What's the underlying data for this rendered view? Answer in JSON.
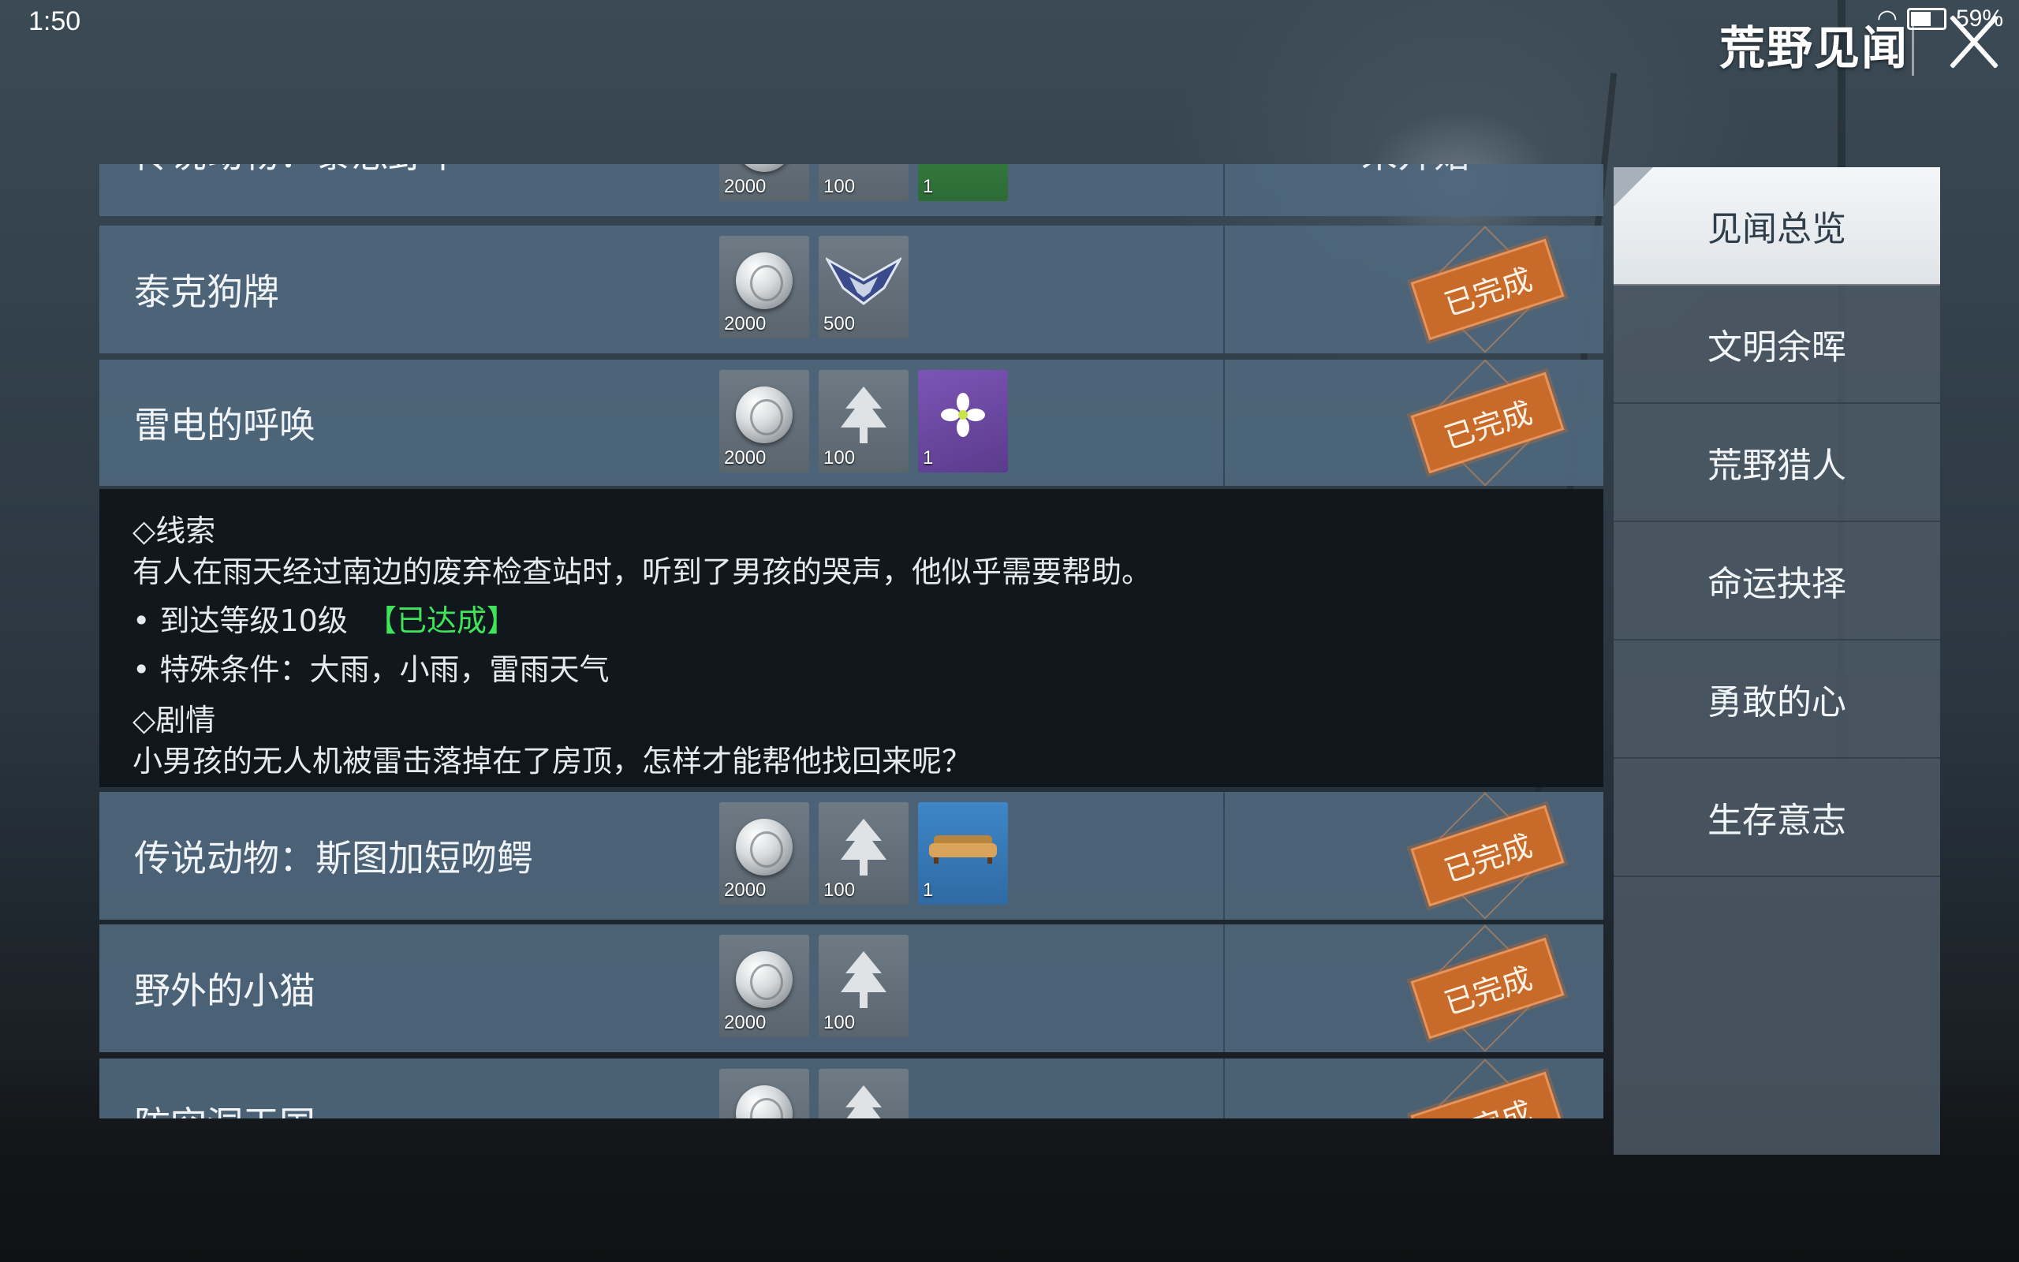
{
  "status_bar": {
    "time": "1:50",
    "battery": "59%"
  },
  "header": {
    "title": "荒野见闻"
  },
  "sidebar": {
    "tabs": [
      {
        "label": "见闻总览",
        "active": true
      },
      {
        "label": "文明余晖",
        "active": false
      },
      {
        "label": "荒野猎人",
        "active": false
      },
      {
        "label": "命运抉择",
        "active": false
      },
      {
        "label": "勇敢的心",
        "active": false
      },
      {
        "label": "生存意志",
        "active": false
      }
    ]
  },
  "quests": [
    {
      "name": "传说动物：泰怒野牛",
      "rewards": [
        {
          "type": "coin",
          "qty": "2000"
        },
        {
          "type": "badge",
          "qty": "100"
        },
        {
          "type": "green",
          "qty": "1"
        }
      ],
      "status": "未开始"
    },
    {
      "name": "泰克狗牌",
      "rewards": [
        {
          "type": "coin",
          "qty": "2000"
        },
        {
          "type": "badge",
          "qty": "500"
        }
      ],
      "status": "已完成"
    },
    {
      "name": "雷电的呼唤",
      "rewards": [
        {
          "type": "coin",
          "qty": "2000"
        },
        {
          "type": "tree",
          "qty": "100"
        },
        {
          "type": "flower",
          "qty": "1"
        }
      ],
      "status": "已完成"
    },
    {
      "name": "传说动物：斯图加短吻鳄",
      "rewards": [
        {
          "type": "coin",
          "qty": "2000"
        },
        {
          "type": "tree",
          "qty": "100"
        },
        {
          "type": "sofa",
          "qty": "1"
        }
      ],
      "status": "已完成"
    },
    {
      "name": "野外的小猫",
      "rewards": [
        {
          "type": "coin",
          "qty": "2000"
        },
        {
          "type": "tree",
          "qty": "100"
        }
      ],
      "status": "已完成"
    },
    {
      "name": "防空洞王国",
      "rewards": [
        {
          "type": "coin",
          "qty": ""
        },
        {
          "type": "tree",
          "qty": ""
        }
      ],
      "status": "已完成"
    }
  ],
  "detail": {
    "clue_heading": "◇线索",
    "clue_text": "有人在雨天经过南边的废弃检查站时，听到了男孩的哭声，他似乎需要帮助。",
    "cond1_label": "• 到达等级10级",
    "cond1_status": "【已达成】",
    "cond2": "• 特殊条件：大雨，小雨，雷雨天气",
    "story_heading": "◇剧情",
    "story_text": "小男孩的无人机被雷击落掉在了房顶，怎样才能帮他找回来呢？"
  }
}
